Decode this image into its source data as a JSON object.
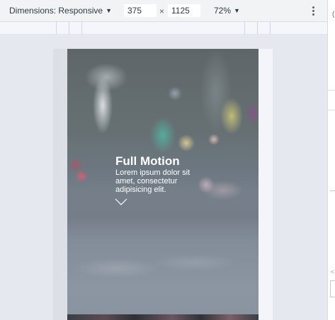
{
  "toolbar": {
    "dimensions_label": "Dimensions: Responsive",
    "width_value": "375",
    "times_symbol": "×",
    "height_value": "1125",
    "zoom_label": "72%"
  },
  "edge": {
    "top_char": "(",
    "arrow_char": "<",
    "resizer_dots": "⋯"
  },
  "hero": {
    "title": "Full Motion",
    "text": "Lorem ipsum dolor sit amet, consectetur adipisicing elit."
  },
  "icons": {
    "dimensions_caret": "caret-down-icon",
    "zoom_caret": "caret-down-icon",
    "more": "more-vertical-icon",
    "scroll_down": "chevron-down-icon"
  }
}
